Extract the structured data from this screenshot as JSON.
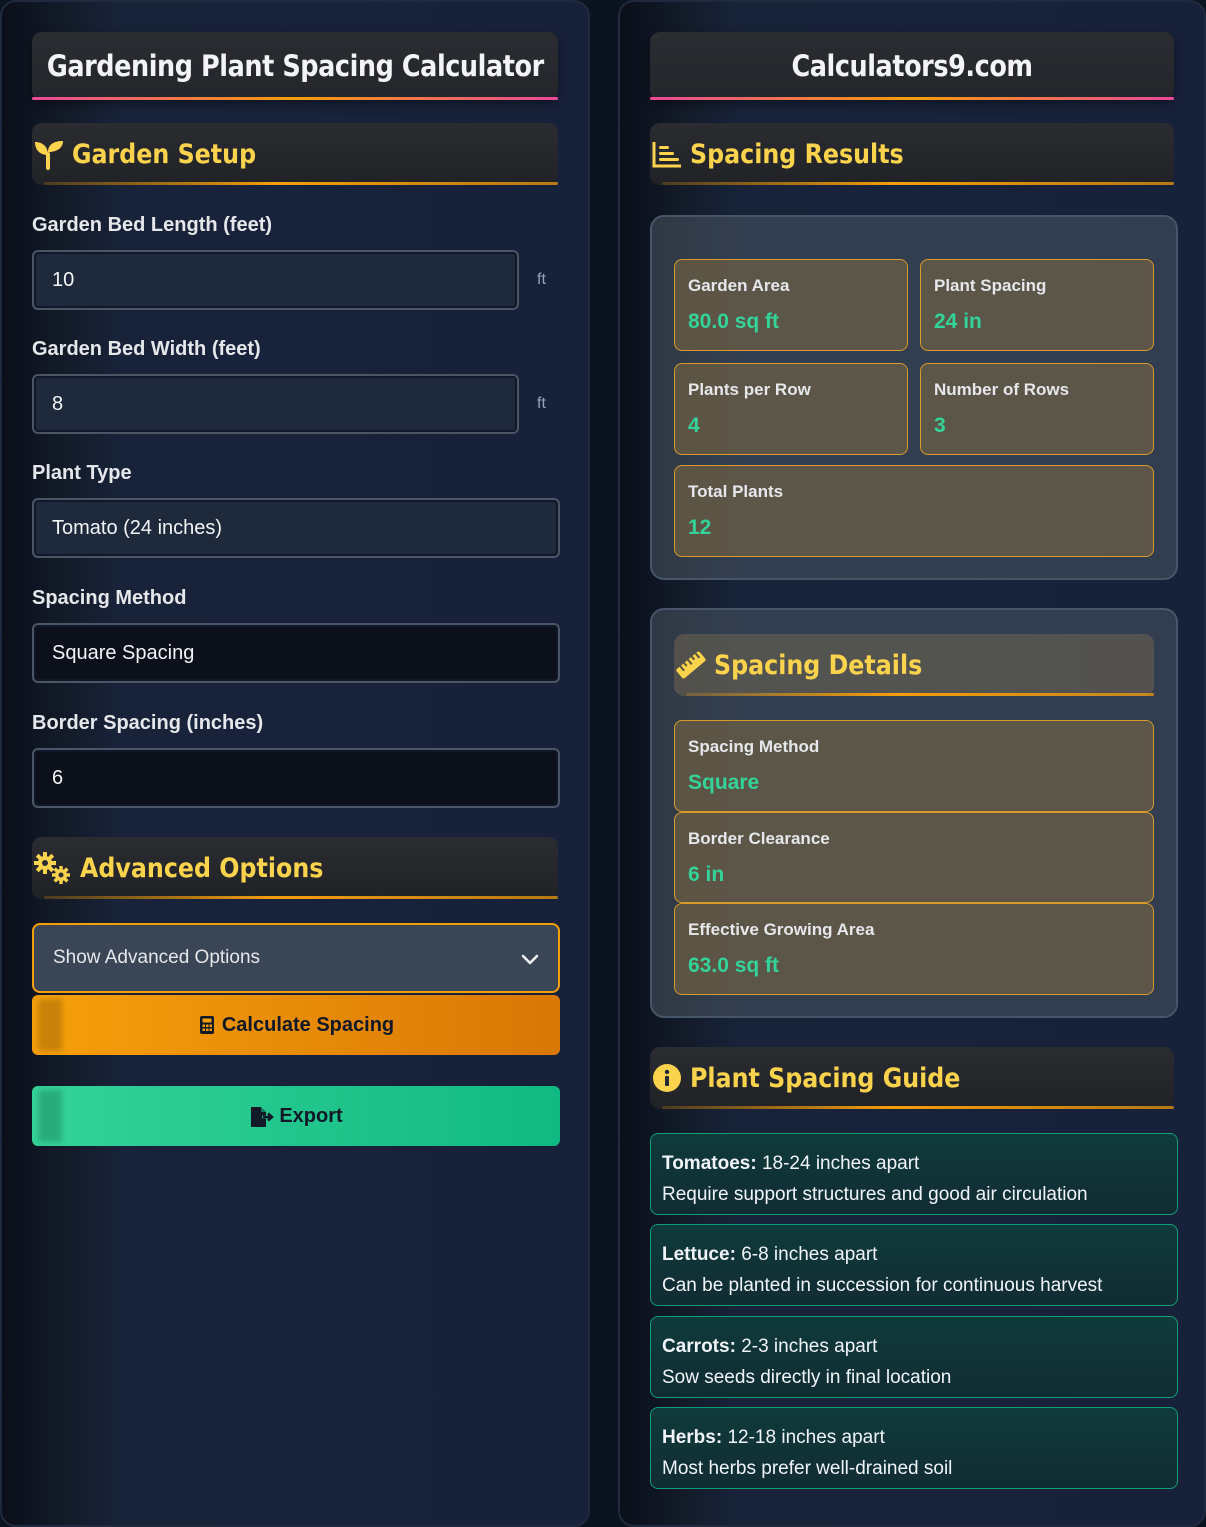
{
  "left": {
    "title": "Gardening Plant Spacing Calculator",
    "garden_setup": {
      "heading": "Garden Setup",
      "icon": "seedling-icon",
      "length": {
        "label": "Garden Bed Length (feet)",
        "value": "10",
        "unit": "ft"
      },
      "width": {
        "label": "Garden Bed Width (feet)",
        "value": "8",
        "unit": "ft"
      },
      "plant_type": {
        "label": "Plant Type",
        "value": "Tomato (24 inches)"
      },
      "spacing_method": {
        "label": "Spacing Method",
        "value": "Square Spacing"
      },
      "border_spacing": {
        "label": "Border Spacing (inches)",
        "value": "6"
      }
    },
    "advanced": {
      "heading": "Advanced Options",
      "icon": "gears-icon",
      "select_label": "Show Advanced Options"
    },
    "calculate_label": "Calculate Spacing",
    "export_label": "Export"
  },
  "right": {
    "title": "Calculators9.com",
    "results": {
      "heading": "Spacing Results",
      "icon": "chart-bar-icon",
      "garden_area": {
        "label": "Garden Area",
        "value": "80.0 sq ft"
      },
      "plant_spacing": {
        "label": "Plant Spacing",
        "value": "24 in"
      },
      "plants_per_row": {
        "label": "Plants per Row",
        "value": "4"
      },
      "number_of_rows": {
        "label": "Number of Rows",
        "value": "3"
      },
      "total_plants": {
        "label": "Total Plants",
        "value": "12"
      }
    },
    "details": {
      "heading": "Spacing Details",
      "icon": "ruler-icon",
      "method": {
        "label": "Spacing Method",
        "value": "Square"
      },
      "border": {
        "label": "Border Clearance",
        "value": "6 in"
      },
      "effective": {
        "label": "Effective Growing Area",
        "value": "63.0 sq ft"
      }
    },
    "guide": {
      "heading": "Plant Spacing Guide",
      "icon": "info-circle-icon",
      "items": [
        {
          "name": "Tomatoes:",
          "spacing": "18-24 inches apart",
          "note": "Require support structures and good air circulation"
        },
        {
          "name": "Lettuce:",
          "spacing": "6-8 inches apart",
          "note": "Can be planted in succession for continuous harvest"
        },
        {
          "name": "Carrots:",
          "spacing": "2-3 inches apart",
          "note": "Sow seeds directly in final location"
        },
        {
          "name": "Herbs:",
          "spacing": "12-18 inches apart",
          "note": "Most herbs prefer well-drained soil"
        }
      ]
    }
  },
  "colors": {
    "accent_yellow": "#fcd34d",
    "accent_orange": "#f59e0b",
    "value_green": "#34d399",
    "title_underline_pink": "#ec4899"
  }
}
